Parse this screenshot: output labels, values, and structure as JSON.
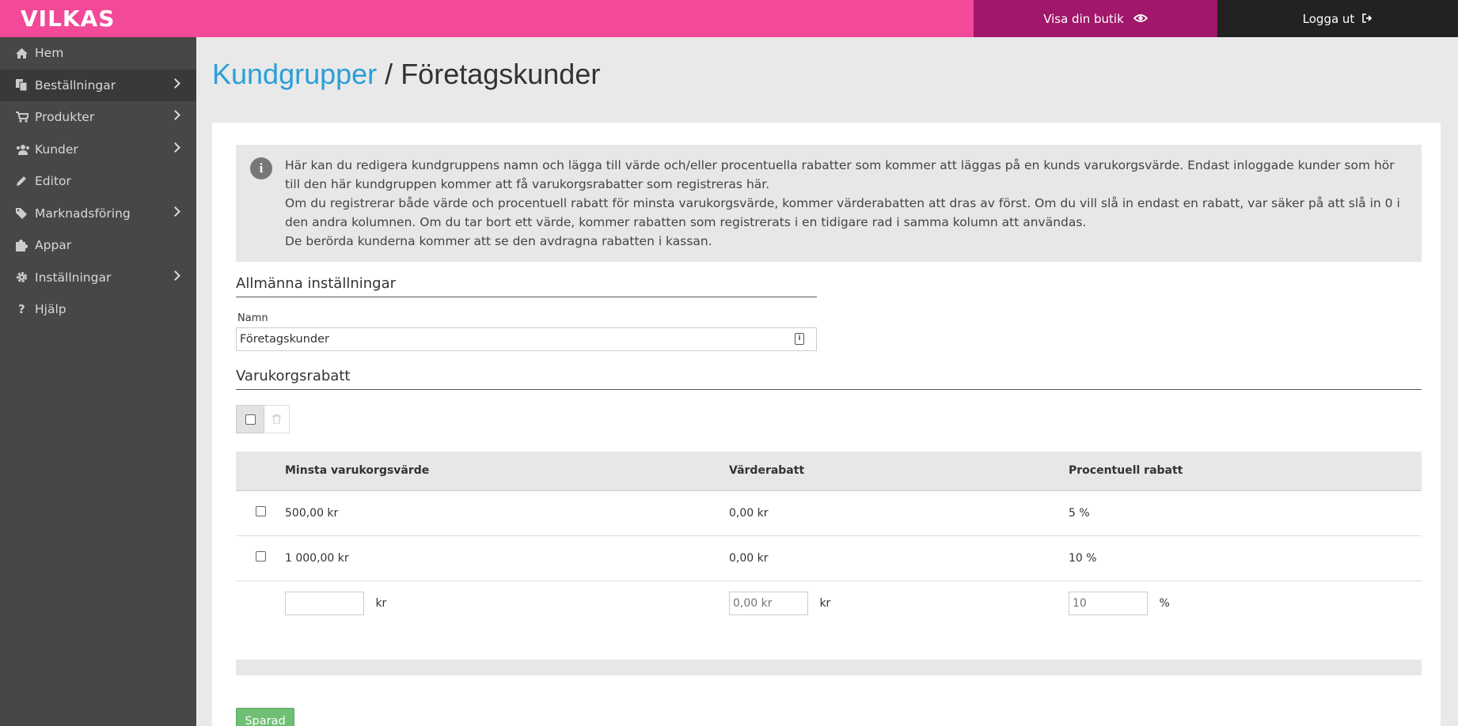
{
  "header": {
    "logo": "VILKAS",
    "show_store": "Visa din butik",
    "logout": "Logga ut"
  },
  "sidebar": {
    "items": [
      {
        "label": "Hem",
        "icon": "home-icon",
        "arrow": false
      },
      {
        "label": "Beställningar",
        "icon": "orders-icon",
        "arrow": true
      },
      {
        "label": "Produkter",
        "icon": "cart-icon",
        "arrow": true
      },
      {
        "label": "Kunder",
        "icon": "users-icon",
        "arrow": true
      },
      {
        "label": "Editor",
        "icon": "pencil-icon",
        "arrow": false
      },
      {
        "label": "Marknadsföring",
        "icon": "tag-icon",
        "arrow": true
      },
      {
        "label": "Appar",
        "icon": "puzzle-icon",
        "arrow": false
      },
      {
        "label": "Inställningar",
        "icon": "gear-icon",
        "arrow": true
      },
      {
        "label": "Hjälp",
        "icon": "question-icon",
        "arrow": false
      }
    ]
  },
  "breadcrumb": {
    "parent": "Kundgrupper",
    "separator": " / ",
    "current": "Företagskunder"
  },
  "info": {
    "p1": "Här kan du redigera kundgruppens namn och lägga till värde och/eller procentuella rabatter som kommer att läggas på en kunds varukorgsvärde. Endast inloggade kunder som hör till den här kundgruppen kommer att få varukorgsrabatter som registreras här.",
    "p2": "Om du registrerar både värde och procentuell rabatt för minsta varukorgsvärde, kommer värderabatten att dras av först. Om du vill slå in endast en rabatt, var säker på att slå in 0 i den andra kolumnen. Om du tar bort ett värde, kommer rabatten som registrerats i en tidigare rad i samma kolumn att användas.",
    "p3": "De berörda kunderna kommer att se den avdragna rabatten i kassan."
  },
  "general": {
    "title": "Allmänna inställningar",
    "name_label": "Namn",
    "name_value": "Företagskunder"
  },
  "discount": {
    "title": "Varukorgsrabatt",
    "columns": [
      "Minsta varukorgsvärde",
      "Värderabatt",
      "Procentuell rabatt"
    ],
    "rows": [
      {
        "min": "500,00 kr",
        "value": "0,00 kr",
        "percent": "5 %"
      },
      {
        "min": "1 000,00 kr",
        "value": "0,00 kr",
        "percent": "10 %"
      }
    ],
    "new_row": {
      "min_value": "",
      "min_unit": "kr",
      "value_placeholder": "0,00 kr",
      "value_unit": "kr",
      "percent_placeholder": "10",
      "percent_unit": "%"
    }
  },
  "save_button": "Sparad"
}
